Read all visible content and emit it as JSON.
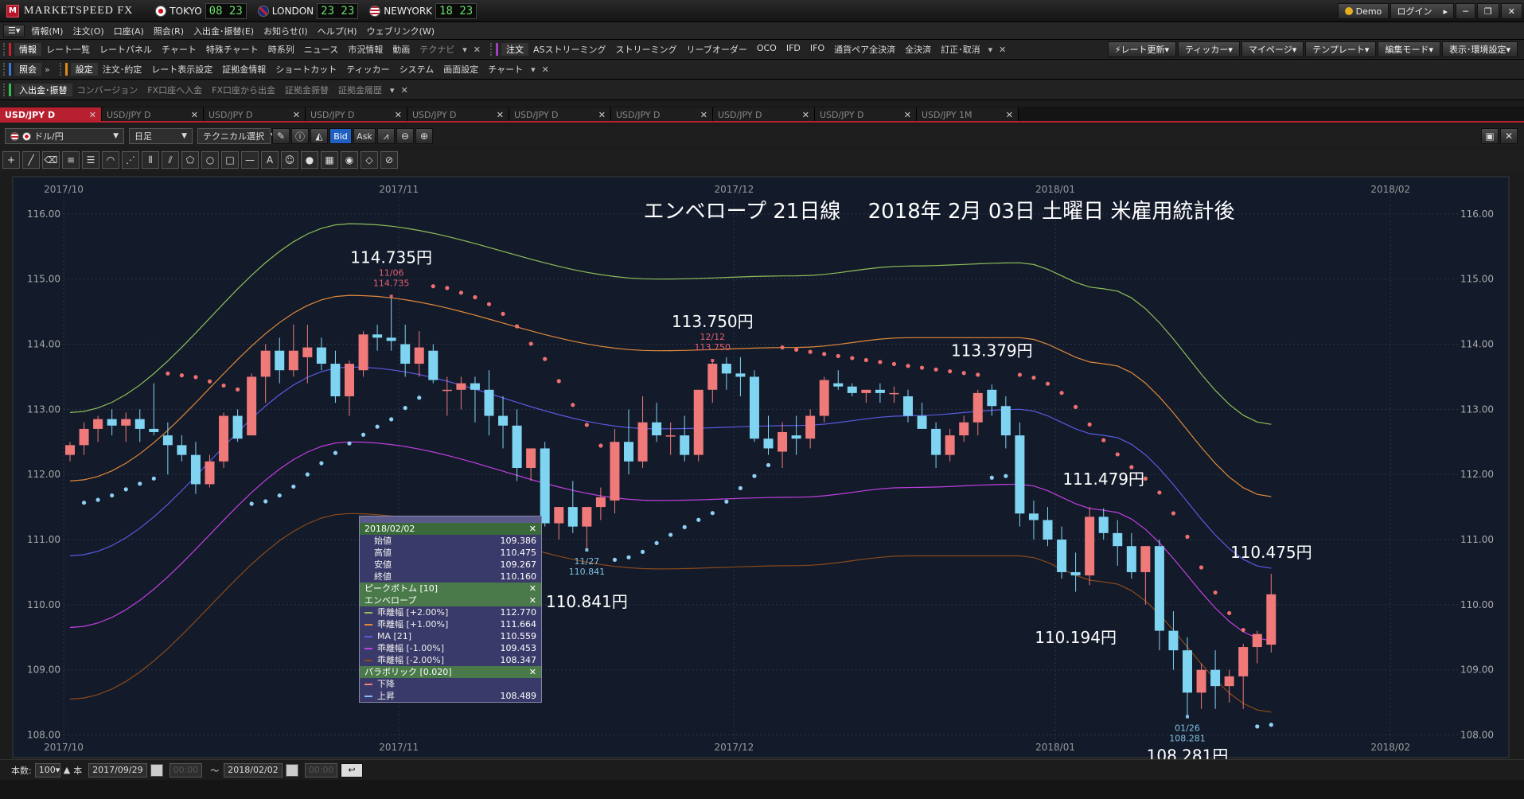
{
  "app": {
    "logo_mark": "M",
    "name": "MARKETSPEED FX"
  },
  "clocks": [
    {
      "city": "TOKYO",
      "time": "08 23",
      "flag": "jp"
    },
    {
      "city": "LONDON",
      "time": "23 23",
      "flag": "uk"
    },
    {
      "city": "NEWYORK",
      "time": "18 23",
      "flag": "us"
    }
  ],
  "window": {
    "demo": "Demo",
    "login": "ログイン",
    "minimize": "─",
    "restore": "❐",
    "close": "✕"
  },
  "menu": [
    "情報(M)",
    "注文(O)",
    "口座(A)",
    "照会(R)",
    "入出金･振替(E)",
    "お知らせ(I)",
    "ヘルプ(H)",
    "ウェブリンク(W)"
  ],
  "toolbar1": {
    "info_label": "情報",
    "info_items": [
      "レート一覧",
      "レートパネル",
      "チャート",
      "特殊チャート",
      "時系列",
      "ニュース",
      "市況情報",
      "動画"
    ],
    "info_dim": "テクナビ",
    "order_label": "注文",
    "order_items": [
      "ASストリーミング",
      "ストリーミング",
      "リーブオーダー",
      "OCO",
      "IFD",
      "IFO",
      "通貨ペア全決済",
      "全決済",
      "訂正･取消"
    ]
  },
  "toolbar_right": [
    "レート更新",
    "ティッカー",
    "マイページ",
    "テンプレート",
    "編集モード",
    "表示･環境設定"
  ],
  "toolbar2": {
    "inq_label": "照会",
    "set_label": "設定",
    "set_items": [
      "注文･約定",
      "レート表示設定",
      "証拠金情報",
      "ショートカット",
      "ティッカー",
      "システム",
      "画面設定",
      "チャート"
    ]
  },
  "toolbar3": {
    "label": "入出金･振替",
    "items": [
      "コンバージョン",
      "FX口座へ入金",
      "FX口座から出金",
      "証拠金振替",
      "証拠金履歴"
    ]
  },
  "tabs": [
    "USD/JPY D",
    "USD/JPY D",
    "USD/JPY D",
    "USD/JPY D",
    "USD/JPY D",
    "USD/JPY D",
    "USD/JPY D",
    "USD/JPY D",
    "USD/JPY D",
    "USD/JPY 1M"
  ],
  "chart_tools": {
    "pair": "ドル/円",
    "period": "日足",
    "tech": "テクニカル選択",
    "bid": "Bid",
    "ask": "Ask"
  },
  "status": {
    "count_label": "本数:",
    "count": "100",
    "unit": "本",
    "from": "2017/09/29",
    "to": "2018/02/02",
    "blank": "00:00",
    "tilde": "～"
  },
  "popup": {
    "date": "2018/02/02",
    "ohlc": [
      {
        "k": "始値",
        "v": "109.386"
      },
      {
        "k": "高値",
        "v": "110.475"
      },
      {
        "k": "安値",
        "v": "109.267"
      },
      {
        "k": "終値",
        "v": "110.160"
      }
    ],
    "peak": "ピークボトム [10]",
    "env": "エンベロープ",
    "env_rows": [
      {
        "k": "乖離幅 [+2.00%]",
        "v": "112.770",
        "c": "#8fbf5a"
      },
      {
        "k": "乖離幅 [+1.00%]",
        "v": "111.664",
        "c": "#e08a3a"
      },
      {
        "k": "MA [21]",
        "v": "110.559",
        "c": "#5a5ae0"
      },
      {
        "k": "乖離幅 [-1.00%]",
        "v": "109.453",
        "c": "#c040e0"
      },
      {
        "k": "乖離幅 [-2.00%]",
        "v": "108.347",
        "c": "#8a4a1a"
      }
    ],
    "sar": "パラボリック [0.020]",
    "sar_rows": [
      {
        "k": "下降",
        "v": "",
        "c": "#f08080"
      },
      {
        "k": "上昇",
        "v": "108.489",
        "c": "#80c0f0"
      }
    ]
  },
  "chart_data": {
    "type": "candlestick",
    "title": "エンベロープ 21日線　 2018年 2月 03日 土曜日 米雇用統計後",
    "ylim": [
      107.75,
      116.45
    ],
    "yticks": [
      "108.00",
      "109.00",
      "110.00",
      "111.00",
      "112.00",
      "113.00",
      "114.00",
      "115.00",
      "116.00"
    ],
    "month_labels": [
      {
        "t": "2017/10",
        "i": 0
      },
      {
        "t": "2017/11",
        "i": 24
      },
      {
        "t": "2017/12",
        "i": 48
      },
      {
        "t": "2018/01",
        "i": 71
      },
      {
        "t": "2018/02",
        "i": 95
      }
    ],
    "candles": [
      [
        112.3,
        112.5,
        112.2,
        112.45
      ],
      [
        112.45,
        112.8,
        112.3,
        112.7
      ],
      [
        112.7,
        112.9,
        112.5,
        112.85
      ],
      [
        112.85,
        113.0,
        112.6,
        112.75
      ],
      [
        112.75,
        112.95,
        112.5,
        112.85
      ],
      [
        112.85,
        113.0,
        112.5,
        112.7
      ],
      [
        112.7,
        113.4,
        112.6,
        112.65
      ],
      [
        112.6,
        112.8,
        112.0,
        112.45
      ],
      [
        112.45,
        112.6,
        112.2,
        112.3
      ],
      [
        112.3,
        112.5,
        111.7,
        111.85
      ],
      [
        111.85,
        112.3,
        111.8,
        112.2
      ],
      [
        112.2,
        112.95,
        112.1,
        112.9
      ],
      [
        112.9,
        113.0,
        112.5,
        112.55
      ],
      [
        112.6,
        113.55,
        112.6,
        113.5
      ],
      [
        113.5,
        114.0,
        113.1,
        113.9
      ],
      [
        113.9,
        114.1,
        113.4,
        113.6
      ],
      [
        113.6,
        114.3,
        113.5,
        113.9
      ],
      [
        113.8,
        114.3,
        113.4,
        113.95
      ],
      [
        113.95,
        114.1,
        113.6,
        113.7
      ],
      [
        113.7,
        113.9,
        113.1,
        113.2
      ],
      [
        113.2,
        113.75,
        112.9,
        113.7
      ],
      [
        113.6,
        114.2,
        113.5,
        114.15
      ],
      [
        114.15,
        114.3,
        113.9,
        114.1
      ],
      [
        114.1,
        114.74,
        113.9,
        114.05
      ],
      [
        114.0,
        114.3,
        113.5,
        113.7
      ],
      [
        113.7,
        114.2,
        113.5,
        113.95
      ],
      [
        113.9,
        114.0,
        113.4,
        113.45
      ],
      [
        113.3,
        113.5,
        112.9,
        113.3
      ],
      [
        113.3,
        113.5,
        113.0,
        113.4
      ],
      [
        113.4,
        113.5,
        112.8,
        113.3
      ],
      [
        113.3,
        113.6,
        112.6,
        112.9
      ],
      [
        112.9,
        113.2,
        112.4,
        112.75
      ],
      [
        112.75,
        113.0,
        111.9,
        112.1
      ],
      [
        112.1,
        112.4,
        111.9,
        112.4
      ],
      [
        112.4,
        112.5,
        111.2,
        111.25
      ],
      [
        111.25,
        111.5,
        111.0,
        111.5
      ],
      [
        111.5,
        111.9,
        111.1,
        111.2
      ],
      [
        111.2,
        111.5,
        110.84,
        111.5
      ],
      [
        111.5,
        111.8,
        111.3,
        111.65
      ],
      [
        111.6,
        112.7,
        111.4,
        112.5
      ],
      [
        112.5,
        113.0,
        112.0,
        112.2
      ],
      [
        112.2,
        113.2,
        112.1,
        112.8
      ],
      [
        112.8,
        113.1,
        112.5,
        112.6
      ],
      [
        112.6,
        112.8,
        112.3,
        112.6
      ],
      [
        112.6,
        112.9,
        112.2,
        112.3
      ],
      [
        112.3,
        113.2,
        112.2,
        113.3
      ],
      [
        113.3,
        113.75,
        113.1,
        113.7
      ],
      [
        113.7,
        113.8,
        113.3,
        113.55
      ],
      [
        113.55,
        113.8,
        113.2,
        113.5
      ],
      [
        113.5,
        113.6,
        112.5,
        112.55
      ],
      [
        112.55,
        112.9,
        112.3,
        112.4
      ],
      [
        112.35,
        112.8,
        112.1,
        112.65
      ],
      [
        112.6,
        112.9,
        112.3,
        112.55
      ],
      [
        112.55,
        113.0,
        112.4,
        112.9
      ],
      [
        112.9,
        113.5,
        112.8,
        113.45
      ],
      [
        113.4,
        113.6,
        113.3,
        113.35
      ],
      [
        113.35,
        113.4,
        113.2,
        113.25
      ],
      [
        113.25,
        113.3,
        113.1,
        113.3
      ],
      [
        113.3,
        113.4,
        113.1,
        113.25
      ],
      [
        113.25,
        113.35,
        113.1,
        113.25
      ],
      [
        113.2,
        113.3,
        112.8,
        112.9
      ],
      [
        112.9,
        113.1,
        112.7,
        112.7
      ],
      [
        112.7,
        112.8,
        112.1,
        112.3
      ],
      [
        112.3,
        112.7,
        112.2,
        112.6
      ],
      [
        112.6,
        112.9,
        112.5,
        112.8
      ],
      [
        112.8,
        113.3,
        112.6,
        113.25
      ],
      [
        113.3,
        113.38,
        112.9,
        113.05
      ],
      [
        113.05,
        113.2,
        112.4,
        112.6
      ],
      [
        112.6,
        112.8,
        111.2,
        111.4
      ],
      [
        111.4,
        111.6,
        111.0,
        111.3
      ],
      [
        111.3,
        111.5,
        110.9,
        111.0
      ],
      [
        111.0,
        111.2,
        110.4,
        110.5
      ],
      [
        110.5,
        110.8,
        110.2,
        110.45
      ],
      [
        110.45,
        111.5,
        110.3,
        111.35
      ],
      [
        111.35,
        111.48,
        111.0,
        111.1
      ],
      [
        111.1,
        111.3,
        110.6,
        110.9
      ],
      [
        110.9,
        111.1,
        110.4,
        110.5
      ],
      [
        110.5,
        110.9,
        110.0,
        110.9
      ],
      [
        110.9,
        111.0,
        109.3,
        109.6
      ],
      [
        109.6,
        109.9,
        109.0,
        109.3
      ],
      [
        109.3,
        109.5,
        108.28,
        108.65
      ],
      [
        108.65,
        109.1,
        108.4,
        109.0
      ],
      [
        109.0,
        109.3,
        108.4,
        108.75
      ],
      [
        108.75,
        109.0,
        108.5,
        108.9
      ],
      [
        108.9,
        109.4,
        108.4,
        109.35
      ],
      [
        109.35,
        109.6,
        109.1,
        109.55
      ],
      [
        109.386,
        110.475,
        109.267,
        110.16
      ]
    ],
    "envelope": [
      {
        "name": "乖離幅 [+2.00%]",
        "color": "#8fbf5a",
        "y0": 112.95,
        "yP1": 115.85,
        "yP2": 115.0,
        "yP3": 115.25,
        "yend": 112.77
      },
      {
        "name": "乖離幅 [+1.00%]",
        "color": "#e08a3a",
        "y0": 111.9,
        "yP1": 114.75,
        "yP2": 113.9,
        "yP3": 114.1,
        "yend": 111.66
      },
      {
        "name": "MA [21]",
        "color": "#5a5ae0",
        "y0": 110.75,
        "yP1": 113.65,
        "yP2": 112.7,
        "yP3": 113.0,
        "yend": 110.56
      },
      {
        "name": "乖離幅 [-1.00%]",
        "color": "#c040e0",
        "y0": 109.65,
        "yP1": 112.5,
        "yP2": 111.6,
        "yP3": 111.85,
        "yend": 109.45
      },
      {
        "name": "乖離幅 [-2.00%]",
        "color": "#8a4a1a",
        "y0": 108.55,
        "yP1": 111.4,
        "yP2": 110.55,
        "yP3": 110.75,
        "yend": 108.35
      }
    ],
    "annotations": [
      {
        "text": "114.735円",
        "i": 23,
        "v": 114.735,
        "dy": -42,
        "big": true
      },
      {
        "text": "113.750円",
        "i": 46,
        "v": 113.75,
        "dy": -42,
        "big": true
      },
      {
        "text": "113.379円",
        "i": 66,
        "v": 113.379,
        "dy": -36,
        "big": true
      },
      {
        "text": "111.479円",
        "i": 74,
        "v": 111.479,
        "dy": -30,
        "big": true
      },
      {
        "text": "110.475円",
        "i": 86,
        "v": 110.475,
        "dy": -20,
        "big": true
      },
      {
        "text": "110.841円",
        "i": 37,
        "v": 110.841,
        "dy": 72,
        "big": true
      },
      {
        "text": "110.194円",
        "i": 72,
        "v": 110.194,
        "dy": 64,
        "big": true
      },
      {
        "text": "108.281円",
        "i": 80,
        "v": 108.281,
        "dy": 56,
        "big": true
      }
    ],
    "peaks": [
      {
        "d": "11/06",
        "v": "114.735",
        "i": 23,
        "up": true
      },
      {
        "d": "12/12",
        "v": "113.750",
        "i": 46,
        "up": true
      },
      {
        "d": "11/27",
        "v": "110.841",
        "i": 37,
        "up": false
      },
      {
        "d": "01/26",
        "v": "108.281",
        "i": 80,
        "up": false
      }
    ]
  }
}
